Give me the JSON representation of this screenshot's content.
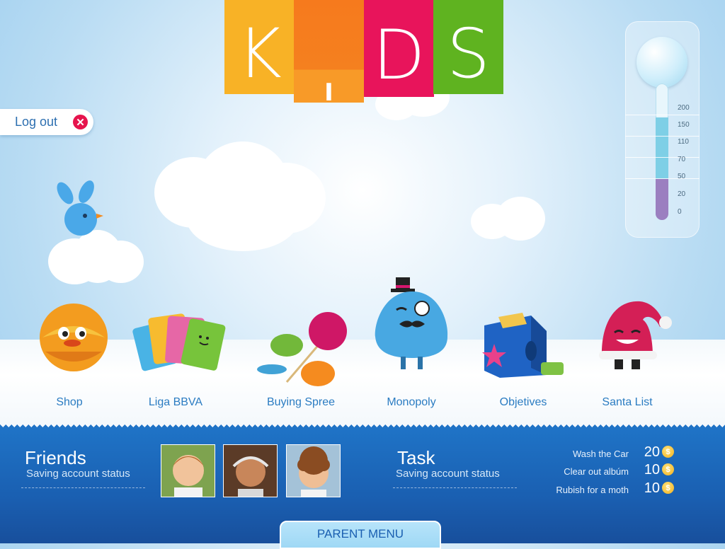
{
  "logo": {
    "letters": [
      "K",
      "I",
      "D",
      "S"
    ]
  },
  "logout": {
    "label": "Log out",
    "icon": "close-icon"
  },
  "thermometer": {
    "scale": [
      "200",
      "150",
      "110",
      "70",
      "50",
      "20",
      "0"
    ],
    "level_fraction": 0.3,
    "target_fraction": 0.75
  },
  "menu": [
    {
      "label": "Shop",
      "icon": "ball-icon"
    },
    {
      "label": "Liga BBVA",
      "icon": "cards-icon"
    },
    {
      "label": "Buying Spree",
      "icon": "candy-icon"
    },
    {
      "label": "Monopoly",
      "icon": "monster-icon"
    },
    {
      "label": "Objetives",
      "icon": "toy-box-icon"
    },
    {
      "label": "Santa List",
      "icon": "santa-hat-icon"
    }
  ],
  "friends": {
    "title": "Friends",
    "subtitle": "Saving account status"
  },
  "task": {
    "title": "Task",
    "subtitle": "Saving account status",
    "items": [
      {
        "name": "Wash the Car",
        "value": "20",
        "coin": "$"
      },
      {
        "name": "Clear out albúm",
        "value": "10",
        "coin": "$"
      },
      {
        "name": "Rubish for a moth",
        "value": "10",
        "coin": "$"
      }
    ]
  },
  "parent_menu": {
    "label": "PARENT MENU"
  },
  "colors": {
    "k": "#f8b226",
    "i": "#f67a1d",
    "d": "#e8145b",
    "s": "#5fb320",
    "panel": "#1a5fb1"
  }
}
